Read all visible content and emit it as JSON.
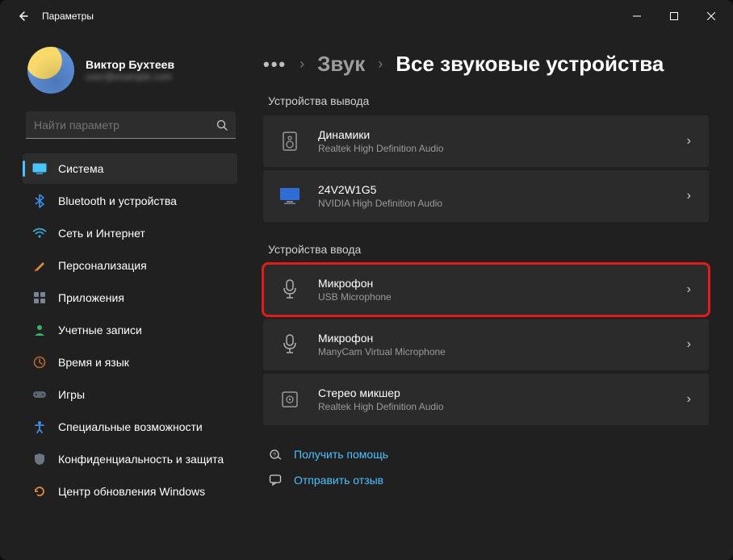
{
  "window": {
    "title": "Параметры"
  },
  "user": {
    "name": "Виктор Бухтеев",
    "email": "user@example.com"
  },
  "search": {
    "placeholder": "Найти параметр"
  },
  "sidebar": {
    "items": [
      {
        "label": "Система",
        "selected": true,
        "icon": "system-icon"
      },
      {
        "label": "Bluetooth и устройства",
        "selected": false,
        "icon": "bluetooth-icon"
      },
      {
        "label": "Сеть и Интернет",
        "selected": false,
        "icon": "wifi-icon"
      },
      {
        "label": "Персонализация",
        "selected": false,
        "icon": "personalization-icon"
      },
      {
        "label": "Приложения",
        "selected": false,
        "icon": "apps-icon"
      },
      {
        "label": "Учетные записи",
        "selected": false,
        "icon": "accounts-icon"
      },
      {
        "label": "Время и язык",
        "selected": false,
        "icon": "time-language-icon"
      },
      {
        "label": "Игры",
        "selected": false,
        "icon": "gaming-icon"
      },
      {
        "label": "Специальные возможности",
        "selected": false,
        "icon": "accessibility-icon"
      },
      {
        "label": "Конфиденциальность и защита",
        "selected": false,
        "icon": "privacy-icon"
      },
      {
        "label": "Центр обновления Windows",
        "selected": false,
        "icon": "update-icon"
      }
    ]
  },
  "breadcrumb": {
    "parent": "Звук",
    "current": "Все звуковые устройства"
  },
  "sections": {
    "output": {
      "title": "Устройства вывода",
      "devices": [
        {
          "title": "Динамики",
          "subtitle": "Realtek High Definition Audio",
          "icon": "speaker-icon"
        },
        {
          "title": "24V2W1G5",
          "subtitle": "NVIDIA High Definition Audio",
          "icon": "monitor-icon"
        }
      ]
    },
    "input": {
      "title": "Устройства ввода",
      "devices": [
        {
          "title": "Микрофон",
          "subtitle": "USB Microphone",
          "icon": "microphone-icon",
          "highlighted": true
        },
        {
          "title": "Микрофон",
          "subtitle": "ManyCam Virtual Microphone",
          "icon": "microphone-icon"
        },
        {
          "title": "Стерео микшер",
          "subtitle": "Realtek High Definition Audio",
          "icon": "mixer-icon"
        }
      ]
    }
  },
  "footer": {
    "help": "Получить помощь",
    "feedback": "Отправить отзыв"
  }
}
